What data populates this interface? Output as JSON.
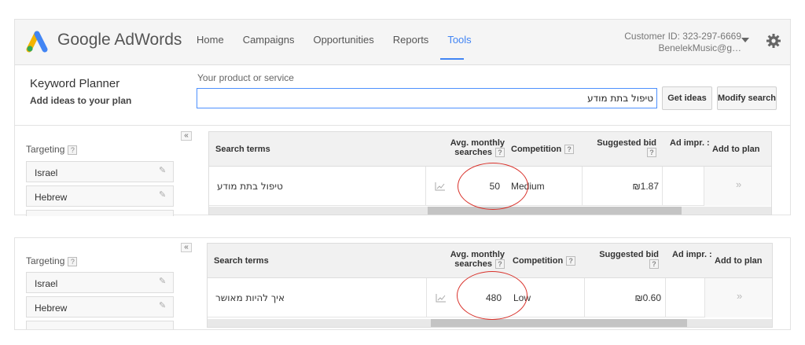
{
  "header": {
    "brand": "Google AdWords",
    "nav": [
      "Home",
      "Campaigns",
      "Opportunities",
      "Reports",
      "Tools"
    ],
    "active_nav": "Tools",
    "customer_id": "Customer ID: 323-297-6669",
    "account": "BenelekMusic@g…"
  },
  "planner": {
    "title": "Keyword Planner",
    "subtitle": "Add ideas to your plan",
    "product_label": "Your product or service",
    "product_value": "טיפול בתת מודע",
    "get_ideas": "Get ideas",
    "modify_search": "Modify search"
  },
  "sidebar": {
    "targeting": "Targeting",
    "qmark": "?",
    "collapse": "«",
    "items": [
      "Israel",
      "Hebrew"
    ]
  },
  "columns": {
    "search_terms": "Search terms",
    "avg_line1": "Avg. monthly",
    "avg_line2": "searches",
    "competition": "Competition",
    "suggested_bid": "Suggested bid",
    "ad_impr": "Ad impr. :",
    "add_to_plan": "Add to plan"
  },
  "rows": [
    {
      "term": "טיפול בתת מודע",
      "searches": "50",
      "competition": "Medium",
      "bid": "₪1.87",
      "add": "»"
    },
    {
      "term": "איך להיות מאושר",
      "searches": "480",
      "competition": "Low",
      "bid": "₪0.60",
      "add": "»"
    }
  ],
  "colors": {
    "accent": "#4285f4",
    "annotation": "#d9322b"
  },
  "icons": [
    "adwords-logo-icon",
    "gear-icon",
    "caret-down-icon",
    "pencil-icon",
    "chart-icon",
    "chevron-right-icon"
  ]
}
